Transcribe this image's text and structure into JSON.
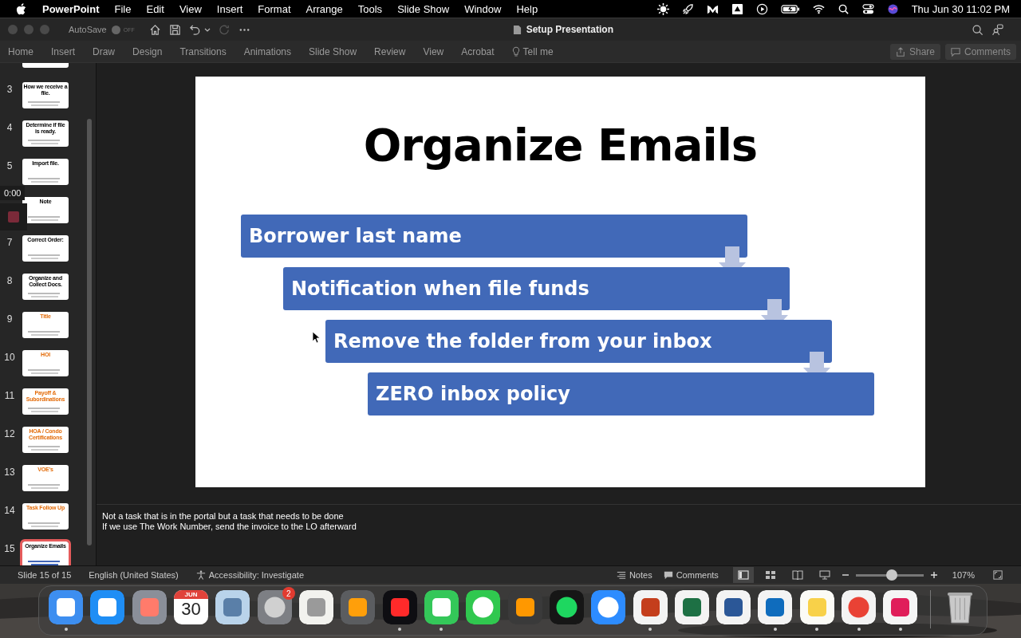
{
  "menu_bar": {
    "app": "PowerPoint",
    "items": [
      "File",
      "Edit",
      "View",
      "Insert",
      "Format",
      "Arrange",
      "Tools",
      "Slide Show",
      "Window",
      "Help"
    ],
    "clock": "Thu Jun 30  11:02 PM"
  },
  "title_bar": {
    "autosave": "AutoSave",
    "autosave_on": false,
    "autosave_state": "OFF",
    "title": "Setup Presentation"
  },
  "ribbon": {
    "tabs": [
      "Home",
      "Insert",
      "Draw",
      "Design",
      "Transitions",
      "Animations",
      "Slide Show",
      "Review",
      "View",
      "Acrobat"
    ],
    "tell_me": "Tell me",
    "share": "Share",
    "comments": "Comments"
  },
  "slides": [
    {
      "number": "3",
      "title": "How we receive a file.",
      "accent_title": false,
      "selected": false
    },
    {
      "number": "4",
      "title": "Determine if file is ready.",
      "accent_title": false,
      "selected": false
    },
    {
      "number": "5",
      "title": "Import file.",
      "accent_title": false,
      "selected": false
    },
    {
      "title": "Note",
      "accent_title": false,
      "selected": false
    },
    {
      "number": "7",
      "title": "Correct Order:",
      "accent_title": false,
      "selected": false
    },
    {
      "number": "8",
      "title": "Organize and Collect Docs.",
      "accent_title": false,
      "selected": false
    },
    {
      "number": "9",
      "title": "Title",
      "accent_title": true,
      "selected": false
    },
    {
      "number": "10",
      "title": "HOI",
      "accent_title": true,
      "selected": false
    },
    {
      "number": "11",
      "title": "Payoff & Subordinations",
      "accent_title": true,
      "selected": false
    },
    {
      "number": "12",
      "title": "HOA / Condo Certifications",
      "accent_title": true,
      "selected": false
    },
    {
      "number": "13",
      "title": "VOE's",
      "accent_title": true,
      "selected": false
    },
    {
      "number": "14",
      "title": "Task Follow Up",
      "accent_title": true,
      "selected": false
    },
    {
      "number": "15",
      "title": "Organize Emails",
      "accent_title": false,
      "selected": true
    }
  ],
  "recording": {
    "time": "0:00"
  },
  "slide": {
    "title": "Organize Emails",
    "steps": [
      "Borrower last name",
      "Notification when file funds",
      "Remove the folder from your inbox",
      "ZERO inbox policy"
    ]
  },
  "notes": [
    "Not a task that is in the portal but a task that needs to be done",
    "If we use The Work Number, send the invoice to the LO afterward"
  ],
  "status_bar": {
    "slide_info": "Slide 15 of 15",
    "language": "English (United States)",
    "accessibility": "Accessibility: Investigate",
    "notes": "Notes",
    "comments": "Comments",
    "zoom": "107%",
    "level": 0.53
  },
  "dock": [
    {
      "kind": "finder",
      "running": true
    },
    {
      "kind": "appstore",
      "running": false
    },
    {
      "kind": "launchpad",
      "running": false
    },
    {
      "kind": "calendar",
      "month": "JUN",
      "day": "30",
      "running": false
    },
    {
      "kind": "preview",
      "running": false
    },
    {
      "kind": "settings",
      "badge": "2",
      "running": false
    },
    {
      "kind": "textedit",
      "running": false
    },
    {
      "kind": "calculator",
      "running": false
    },
    {
      "kind": "acrobat",
      "running": true
    },
    {
      "kind": "messages",
      "running": true
    },
    {
      "kind": "facetime",
      "running": false
    },
    {
      "kind": "sublime",
      "running": false
    },
    {
      "kind": "spotify",
      "running": false
    },
    {
      "kind": "zoom",
      "running": false
    },
    {
      "kind": "powerpoint",
      "running": true
    },
    {
      "kind": "excel",
      "running": false
    },
    {
      "kind": "word",
      "running": false
    },
    {
      "kind": "outlook",
      "running": true
    },
    {
      "kind": "notes",
      "running": true
    },
    {
      "kind": "chrome",
      "running": true
    },
    {
      "kind": "slack",
      "running": true
    },
    {
      "kind": "trash",
      "running": false
    }
  ]
}
